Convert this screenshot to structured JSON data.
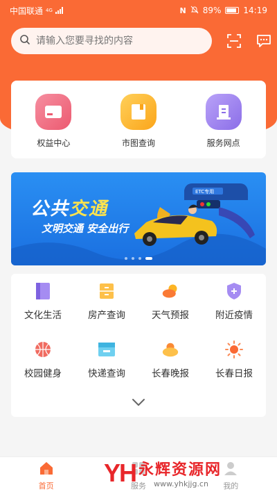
{
  "status_bar": {
    "carrier": "中国联通",
    "network": "4G",
    "battery": "89%",
    "time": "14:19"
  },
  "search": {
    "placeholder": "请输入您要寻找的内容"
  },
  "quick_links": [
    {
      "label": "权益中心",
      "icon": "card-icon",
      "color": "#f06b80"
    },
    {
      "label": "市图查询",
      "icon": "book-icon",
      "color": "#fdb524"
    },
    {
      "label": "服务网点",
      "icon": "building-icon",
      "color": "#9b7ff0"
    }
  ],
  "banner": {
    "title_part1": "公共",
    "title_part2": "交通",
    "subtitle": "文明交通  安全出行",
    "sign": "ETC专用",
    "slides": 4,
    "active_slide": 4
  },
  "services": [
    {
      "label": "文化生活",
      "icon": "book-icon",
      "color": "#9b7ff0"
    },
    {
      "label": "房产查询",
      "icon": "archive-icon",
      "color": "#fdb524"
    },
    {
      "label": "天气预报",
      "icon": "weather-icon",
      "color": "#fa8a35"
    },
    {
      "label": "附近疫情",
      "icon": "shield-plus-icon",
      "color": "#9b7ff0"
    },
    {
      "label": "校园健身",
      "icon": "basketball-icon",
      "color": "#f06b60"
    },
    {
      "label": "快递查询",
      "icon": "package-icon",
      "color": "#4fc0e8"
    },
    {
      "label": "长春晚报",
      "icon": "sun-cloud-icon",
      "color": "#fdb524"
    },
    {
      "label": "长春日报",
      "icon": "sun-icon",
      "color": "#fa6a35"
    }
  ],
  "tabbar": [
    {
      "label": "首页",
      "active": true
    },
    {
      "label": "服务",
      "active": false
    },
    {
      "label": "我的",
      "active": false
    }
  ],
  "watermark": {
    "logo": "YH",
    "name": "永辉资源网",
    "url": "www.yhkjjg.cn"
  },
  "colors": {
    "brand": "#fa6a35",
    "banner": "#1a6fe0"
  }
}
